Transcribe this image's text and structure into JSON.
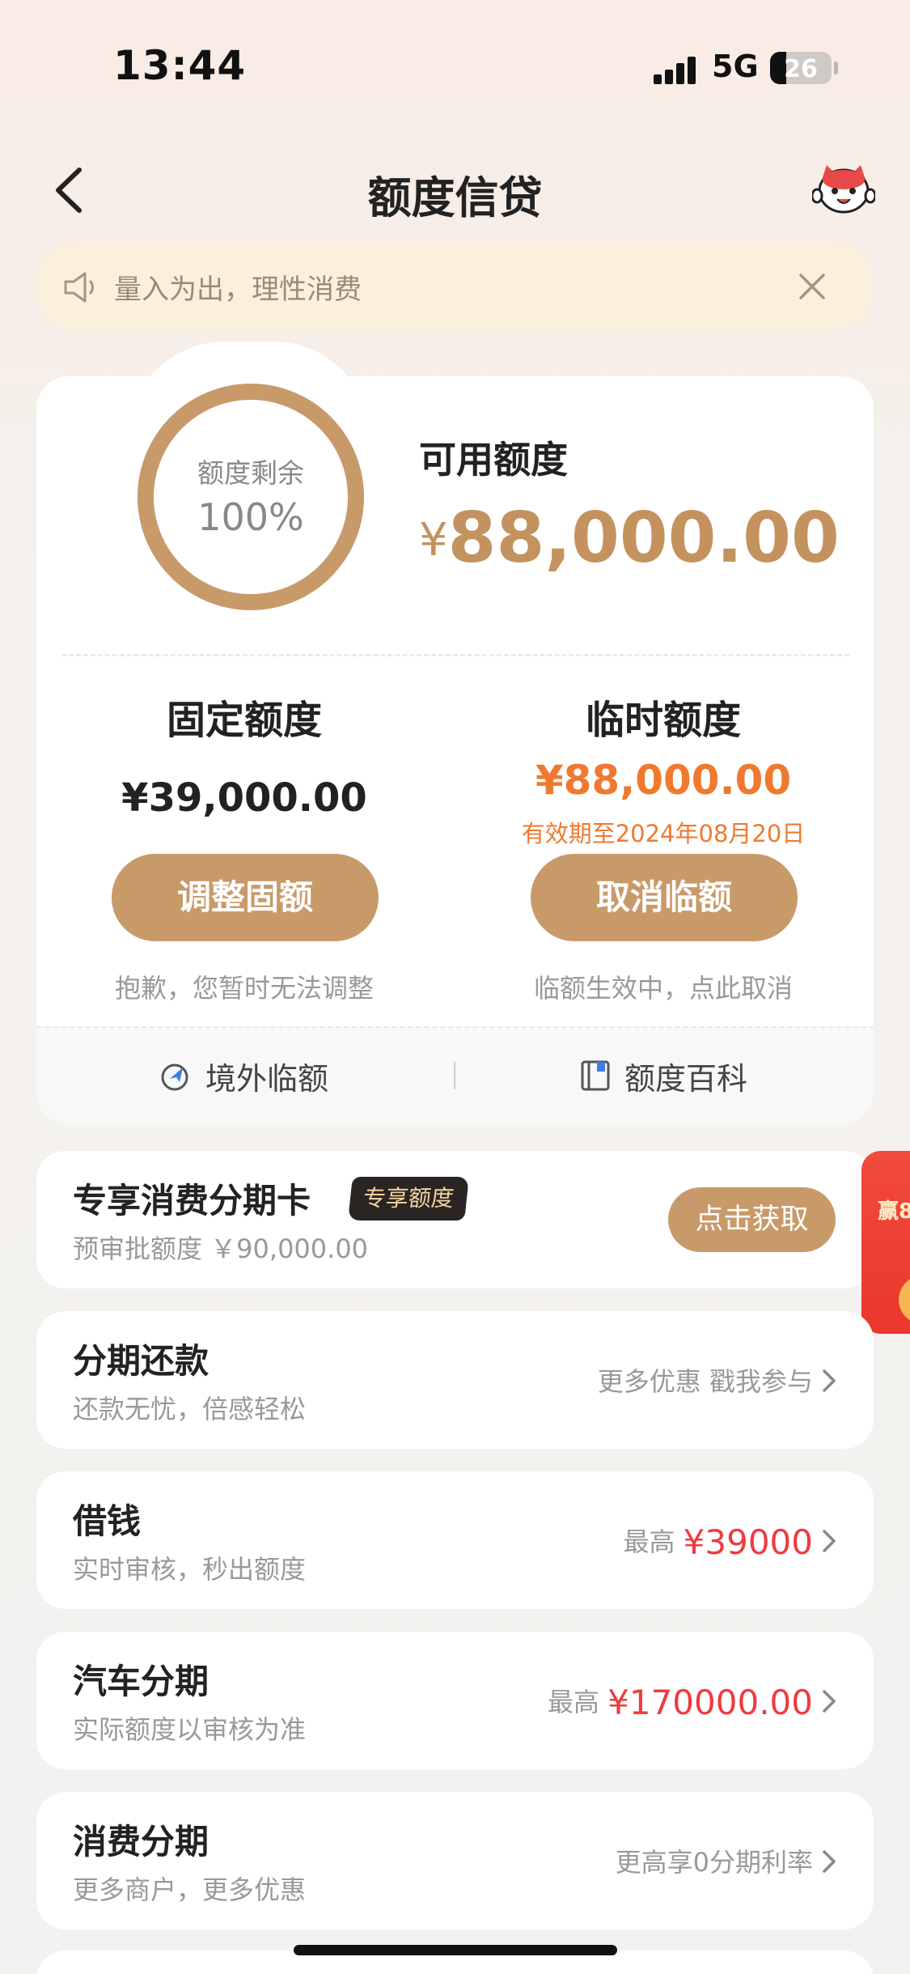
{
  "status_bar": {
    "time": "13:44",
    "network": "5G",
    "battery": "26",
    "battery_level": 0.26
  },
  "nav": {
    "title": "额度信贷",
    "back_icon": "chevron-left-icon",
    "mascot_icon": "mascot-icon"
  },
  "notice": {
    "text": "量入为出，理性消费",
    "icon": "speaker-icon",
    "close_icon": "close-icon"
  },
  "summary": {
    "ring_label": "额度剩余",
    "ring_value": "100%",
    "ring_fraction": 1.0,
    "available_label": "可用额度",
    "available_currency": "¥",
    "available_amount": "88,000.00"
  },
  "fixed": {
    "title": "固定额度",
    "amount": "¥39,000.00",
    "button": "调整固额",
    "hint": "抱歉，您暂时无法调整"
  },
  "temporary": {
    "title": "临时额度",
    "amount": "¥88,000.00",
    "expiry": "有效期至2024年08月20日",
    "button": "取消临额",
    "hint": "临额生效中，点此取消"
  },
  "footer_links": [
    {
      "label": "境外临额",
      "icon": "globe-plane-icon"
    },
    {
      "label": "额度百科",
      "icon": "book-icon"
    }
  ],
  "exclusive_card": {
    "title": "专享消费分期卡",
    "badge": "专享额度",
    "sub": "预审批额度 ￥90,000.00",
    "button": "点击获取"
  },
  "list": [
    {
      "title": "分期还款",
      "sub": "还款无忧，倍感轻松",
      "right_text": "更多优惠 戳我参与",
      "right_value": ""
    },
    {
      "title": "借钱",
      "sub": "实时审核，秒出额度",
      "right_text": "最高 ",
      "right_value": "¥39000"
    },
    {
      "title": "汽车分期",
      "sub": "实际额度以审核为准",
      "right_text": "最高 ",
      "right_value": "¥170000.00"
    },
    {
      "title": "消费分期",
      "sub": "更多商户，更多优惠",
      "right_text": "更高享0分期利率",
      "right_value": ""
    }
  ],
  "floating_promo": {
    "text": "赢8"
  },
  "colors": {
    "accent": "#c89a6a",
    "amount": "#c4925e",
    "orange": "#ef7a2f",
    "red": "#ee3b40"
  }
}
